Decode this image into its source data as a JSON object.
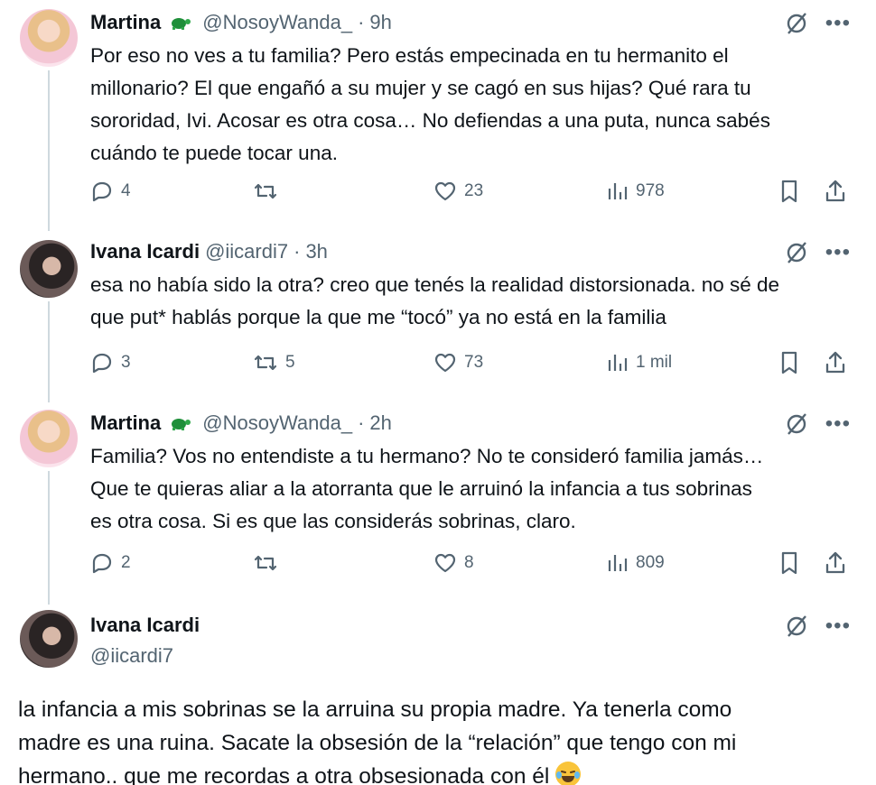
{
  "tweets": [
    {
      "author": "Martina",
      "handle": "@NosoyWanda_",
      "time": "9h",
      "text_lines": [
        "Por eso no ves a tu familia? Pero estás empecinada en tu hermanito el",
        "millonario? El que engañó a su mujer y se cagó en sus hijas? Qué rara tu",
        "sororidad, Ivi. Acosar es otra cosa… No defiendas a una puta, nunca sabés",
        "cuándo te puede tocar una."
      ],
      "replies": "4",
      "retweets": "",
      "likes": "23",
      "views": "978"
    },
    {
      "author": "Ivana Icardi",
      "handle": "@iicardi7",
      "time": "3h",
      "text_lines": [
        "esa no había sido la otra? creo que tenés la realidad distorsionada. no sé de",
        "que put* hablás porque la que me “tocó” ya no está en la familia"
      ],
      "replies": "3",
      "retweets": "5",
      "likes": "73",
      "views": "1 mil"
    },
    {
      "author": "Martina",
      "handle": "@NosoyWanda_",
      "time": "2h",
      "text_lines": [
        "Familia? Vos no entendiste a tu hermano? No te consideró familia jamás…",
        "Que te quieras aliar a la atorranta que le arruinó la infancia a tus sobrinas",
        "es otra cosa. Si es que las considerás sobrinas, claro."
      ],
      "replies": "2",
      "retweets": "",
      "likes": "8",
      "views": "809"
    }
  ],
  "main_tweet": {
    "author": "Ivana Icardi",
    "handle": "@iicardi7",
    "text_lines": [
      "la infancia a mis sobrinas se la arruina su propia madre. Ya tenerla como",
      "madre es una ruina. Sacate la obsesión de la “relación” que tengo con mi",
      "hermano.. que me recordas a otra obsesionada con él"
    ]
  },
  "icons": {
    "reply": "reply-icon",
    "retweet": "retweet-icon",
    "like": "heart-icon",
    "views": "views-icon",
    "bookmark": "bookmark-icon",
    "share": "share-icon",
    "grok": "grok-icon",
    "more": "more-icon",
    "emoji": "laughing-crying-emoji"
  },
  "colors": {
    "text": "#0f1419",
    "muted": "#536471",
    "line": "#cfd9de",
    "turtle": "#1f8f3a"
  }
}
